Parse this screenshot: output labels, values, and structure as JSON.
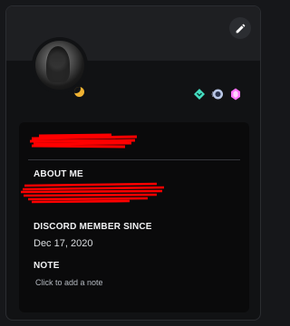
{
  "profile": {
    "edit_icon": "pencil-icon",
    "status": "idle",
    "status_icon": "moon-icon",
    "badges": [
      "hypesquad-balance-badge",
      "nitro-badge",
      "boost-badge"
    ]
  },
  "sections": {
    "about_me_title": "ABOUT ME",
    "member_since_title": "DISCORD MEMBER SINCE",
    "member_since_date": "Dec 17, 2020",
    "note_title": "NOTE",
    "note_placeholder": "Click to add a note"
  },
  "colors": {
    "background": "#111214",
    "redaction": "#ff0000",
    "idle": "#f0b232"
  }
}
